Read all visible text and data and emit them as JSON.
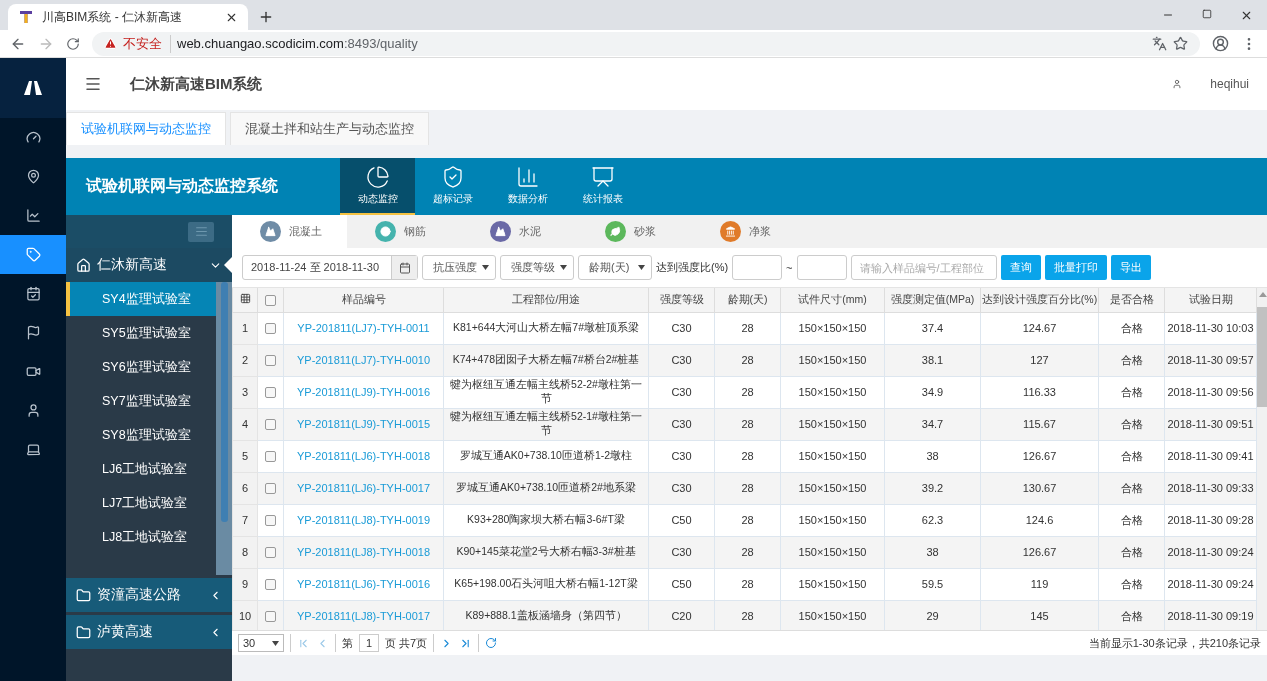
{
  "browser": {
    "tab_title": "川高BIM系统 - 仁沐新高速",
    "security": "不安全",
    "url_host": "web.chuangao.scodicim.com",
    "url_path": ":8493/quality"
  },
  "rail": {
    "items": [
      {
        "selected": false
      },
      {
        "selected": false
      },
      {
        "selected": false
      },
      {
        "selected": true
      },
      {
        "selected": false
      },
      {
        "selected": false
      },
      {
        "selected": false
      },
      {
        "selected": false
      },
      {
        "selected": false
      }
    ]
  },
  "header": {
    "title": "仁沐新高速BIM系统",
    "user": "heqihui"
  },
  "page_tabs": [
    {
      "label": "试验机联网与动态监控",
      "selected": true
    },
    {
      "label": "混凝土拌和站生产与动态监控",
      "selected": false
    }
  ],
  "system": {
    "title": "试验机联网与动态监控系统",
    "nav": [
      {
        "label": "动态监控",
        "selected": true
      },
      {
        "label": "超标记录",
        "selected": false
      },
      {
        "label": "数据分析",
        "selected": false
      },
      {
        "label": "统计报表",
        "selected": false
      }
    ]
  },
  "tree": {
    "groups": [
      {
        "label": "仁沐新高速",
        "expanded": true,
        "children": [
          {
            "label": "SY4监理试验室",
            "selected": true
          },
          {
            "label": "SY5监理试验室",
            "selected": false
          },
          {
            "label": "SY6监理试验室",
            "selected": false
          },
          {
            "label": "SY7监理试验室",
            "selected": false
          },
          {
            "label": "SY8监理试验室",
            "selected": false
          },
          {
            "label": "LJ6工地试验室",
            "selected": false
          },
          {
            "label": "LJ7工地试验室",
            "selected": false
          },
          {
            "label": "LJ8工地试验室",
            "selected": false
          }
        ]
      },
      {
        "label": "资潼高速公路",
        "expanded": false
      },
      {
        "label": "泸黄高速",
        "expanded": false
      }
    ]
  },
  "materials": [
    {
      "label": "混凝土",
      "color": "#6f8ca6",
      "selected": true
    },
    {
      "label": "钢筋",
      "color": "#45b3ad",
      "selected": false
    },
    {
      "label": "水泥",
      "color": "#6a69a6",
      "selected": false
    },
    {
      "label": "砂浆",
      "color": "#5cb85c",
      "selected": false
    },
    {
      "label": "净浆",
      "color": "#e07b2a",
      "selected": false
    }
  ],
  "filters": {
    "date_range": "2018-11-24 至 2018-11-30",
    "selects": [
      "抗压强度",
      "强度等级",
      "龄期(天)"
    ],
    "ratio_label": "达到强度比(%)",
    "range_sep": "~",
    "search_placeholder": "请输入样品编号/工程部位",
    "buttons": [
      "查询",
      "批量打印",
      "导出"
    ]
  },
  "table": {
    "header_checked": false,
    "columns": [
      "样品编号",
      "工程部位/用途",
      "强度等级",
      "龄期(天)",
      "试件尺寸(mm)",
      "强度测定值(MPa)",
      "达到设计强度百分比(%)",
      "是否合格",
      "试验日期"
    ],
    "rows": [
      {
        "index": "1",
        "checked": false,
        "cells": [
          "YP-201811(LJ7)-TYH-0011",
          "K81+644大河山大桥左幅7#墩桩顶系梁",
          "C30",
          "28",
          "150×150×150",
          "37.4",
          "124.67",
          "合格",
          "2018-11-30 10:03"
        ]
      },
      {
        "index": "2",
        "checked": false,
        "cells": [
          "YP-201811(LJ7)-TYH-0010",
          "K74+478团囡子大桥左幅7#桥台2#桩基",
          "C30",
          "28",
          "150×150×150",
          "38.1",
          "127",
          "合格",
          "2018-11-30 09:57"
        ]
      },
      {
        "index": "3",
        "checked": false,
        "cells": [
          "YP-201811(LJ9)-TYH-0016",
          "犍为枢纽互通左幅主线桥52-2#墩柱第一节",
          "C30",
          "28",
          "150×150×150",
          "34.9",
          "116.33",
          "合格",
          "2018-11-30 09:56"
        ]
      },
      {
        "index": "4",
        "checked": false,
        "cells": [
          "YP-201811(LJ9)-TYH-0015",
          "犍为枢纽互通左幅主线桥52-1#墩柱第一节",
          "C30",
          "28",
          "150×150×150",
          "34.7",
          "115.67",
          "合格",
          "2018-11-30 09:51"
        ]
      },
      {
        "index": "5",
        "checked": false,
        "cells": [
          "YP-201811(LJ6)-TYH-0018",
          "罗城互通AK0+738.10匝道桥1-2墩柱",
          "C30",
          "28",
          "150×150×150",
          "38",
          "126.67",
          "合格",
          "2018-11-30 09:41"
        ]
      },
      {
        "index": "6",
        "checked": false,
        "cells": [
          "YP-201811(LJ6)-TYH-0017",
          "罗城互通AK0+738.10匝道桥2#地系梁",
          "C30",
          "28",
          "150×150×150",
          "39.2",
          "130.67",
          "合格",
          "2018-11-30 09:33"
        ]
      },
      {
        "index": "7",
        "checked": false,
        "cells": [
          "YP-201811(LJ8)-TYH-0019",
          "K93+280陶家坝大桥右幅3-6#T梁",
          "C50",
          "28",
          "150×150×150",
          "62.3",
          "124.6",
          "合格",
          "2018-11-30 09:28"
        ]
      },
      {
        "index": "8",
        "checked": false,
        "cells": [
          "YP-201811(LJ8)-TYH-0018",
          "K90+145菜花堂2号大桥右幅3-3#桩基",
          "C30",
          "28",
          "150×150×150",
          "38",
          "126.67",
          "合格",
          "2018-11-30 09:24"
        ]
      },
      {
        "index": "9",
        "checked": false,
        "cells": [
          "YP-201811(LJ6)-TYH-0016",
          "K65+198.00石头河咀大桥右幅1-12T梁",
          "C50",
          "28",
          "150×150×150",
          "59.5",
          "119",
          "合格",
          "2018-11-30 09:24"
        ]
      },
      {
        "index": "10",
        "checked": false,
        "cells": [
          "YP-201811(LJ8)-TYH-0017",
          "K89+888.1盖板涵墙身（第四节）",
          "C20",
          "28",
          "150×150×150",
          "29",
          "145",
          "合格",
          "2018-11-30 09:19"
        ]
      }
    ]
  },
  "pager": {
    "page_size": "30",
    "page_prefix": "第",
    "page": "1",
    "page_suffix": "页 共7页",
    "summary": "当前显示1-30条记录，共210条记录"
  }
}
